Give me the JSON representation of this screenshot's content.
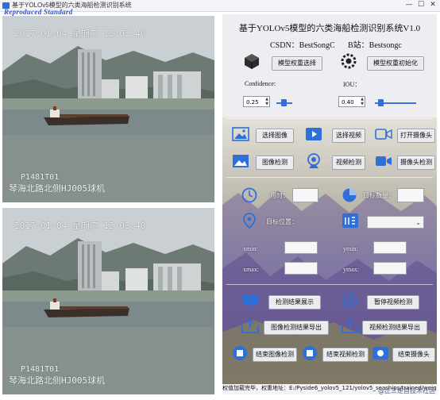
{
  "window": {
    "title": "基于YOLOv5模型的六类海船检测识别系统",
    "minimize": "—",
    "maximize": "☐",
    "close": "✕",
    "logo_text": "Reproduced Standard"
  },
  "videos": [
    {
      "timestamp": "2017-01-04 星期三 12:03:40",
      "camera_id": "P1481T01",
      "location": "琴海北路北侧HJ005球机"
    },
    {
      "timestamp": "2017-01-04 星期三 12:03:40",
      "camera_id": "P1481T01",
      "location": "琴海北路北侧HJ005球机"
    }
  ],
  "panel": {
    "title": "基于YOLOv5模型的六类海船检测识别系统V1.0",
    "csdn": "CSDN：BestSongC",
    "bilibili": "B站：Bestsongc",
    "buttons": {
      "select_weights": "模型权重选择",
      "init_weights": "模型权重初始化",
      "select_image": "选择图像",
      "select_video": "选择视频",
      "open_camera": "打开摄像头",
      "detect_image": "图像检测",
      "detect_video": "视频检测",
      "detect_camera": "摄像头检测",
      "show_results": "检测结果展示",
      "pause_video": "暂停视频检测",
      "export_image": "图像检测结果导出",
      "export_video": "视频检测结果导出",
      "stop_image": "结束图像检测",
      "stop_video": "结束视频检测",
      "stop_camera": "结束摄像头"
    },
    "confidence_label": "Confidence:",
    "confidence_value": "0.25",
    "iou_label": "IOU：",
    "iou_value": "0.40",
    "time_label": "用时：",
    "target_count_label": "目标数量：",
    "target_pos_label": "目标位置：",
    "xmin_label": "xmin:",
    "ymin_label": "ymin:",
    "xmax_label": "xmax:",
    "ymax_label": "ymax:",
    "status": "权值加载完毕，权重地址：E:/Pyside6_yolov5_121/yolov5_seaships/trained/weights/best.pt"
  },
  "watermark": "@正三逆首技术社区",
  "colors": {
    "accent": "#2e6fd9",
    "button_bg": "#e9ebee"
  }
}
